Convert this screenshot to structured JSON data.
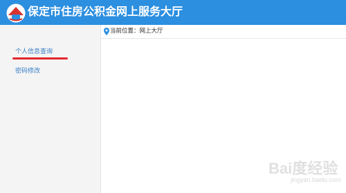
{
  "header": {
    "title": "保定市住房公积金网上服务大厅",
    "background_color": "#2c8fe0",
    "logo_icon": "housing-fund-logo"
  },
  "sidebar": {
    "items": [
      {
        "label": "个人信息查询",
        "active": true,
        "highlight_color": "#e3262a"
      },
      {
        "label": "密码修改",
        "active": false
      }
    ]
  },
  "breadcrumb": {
    "icon": "location-pin-icon",
    "text": "当前位置：网上大厅"
  },
  "watermark": {
    "brand": "Bai度经验",
    "url": "jingyan.baidu.com"
  }
}
